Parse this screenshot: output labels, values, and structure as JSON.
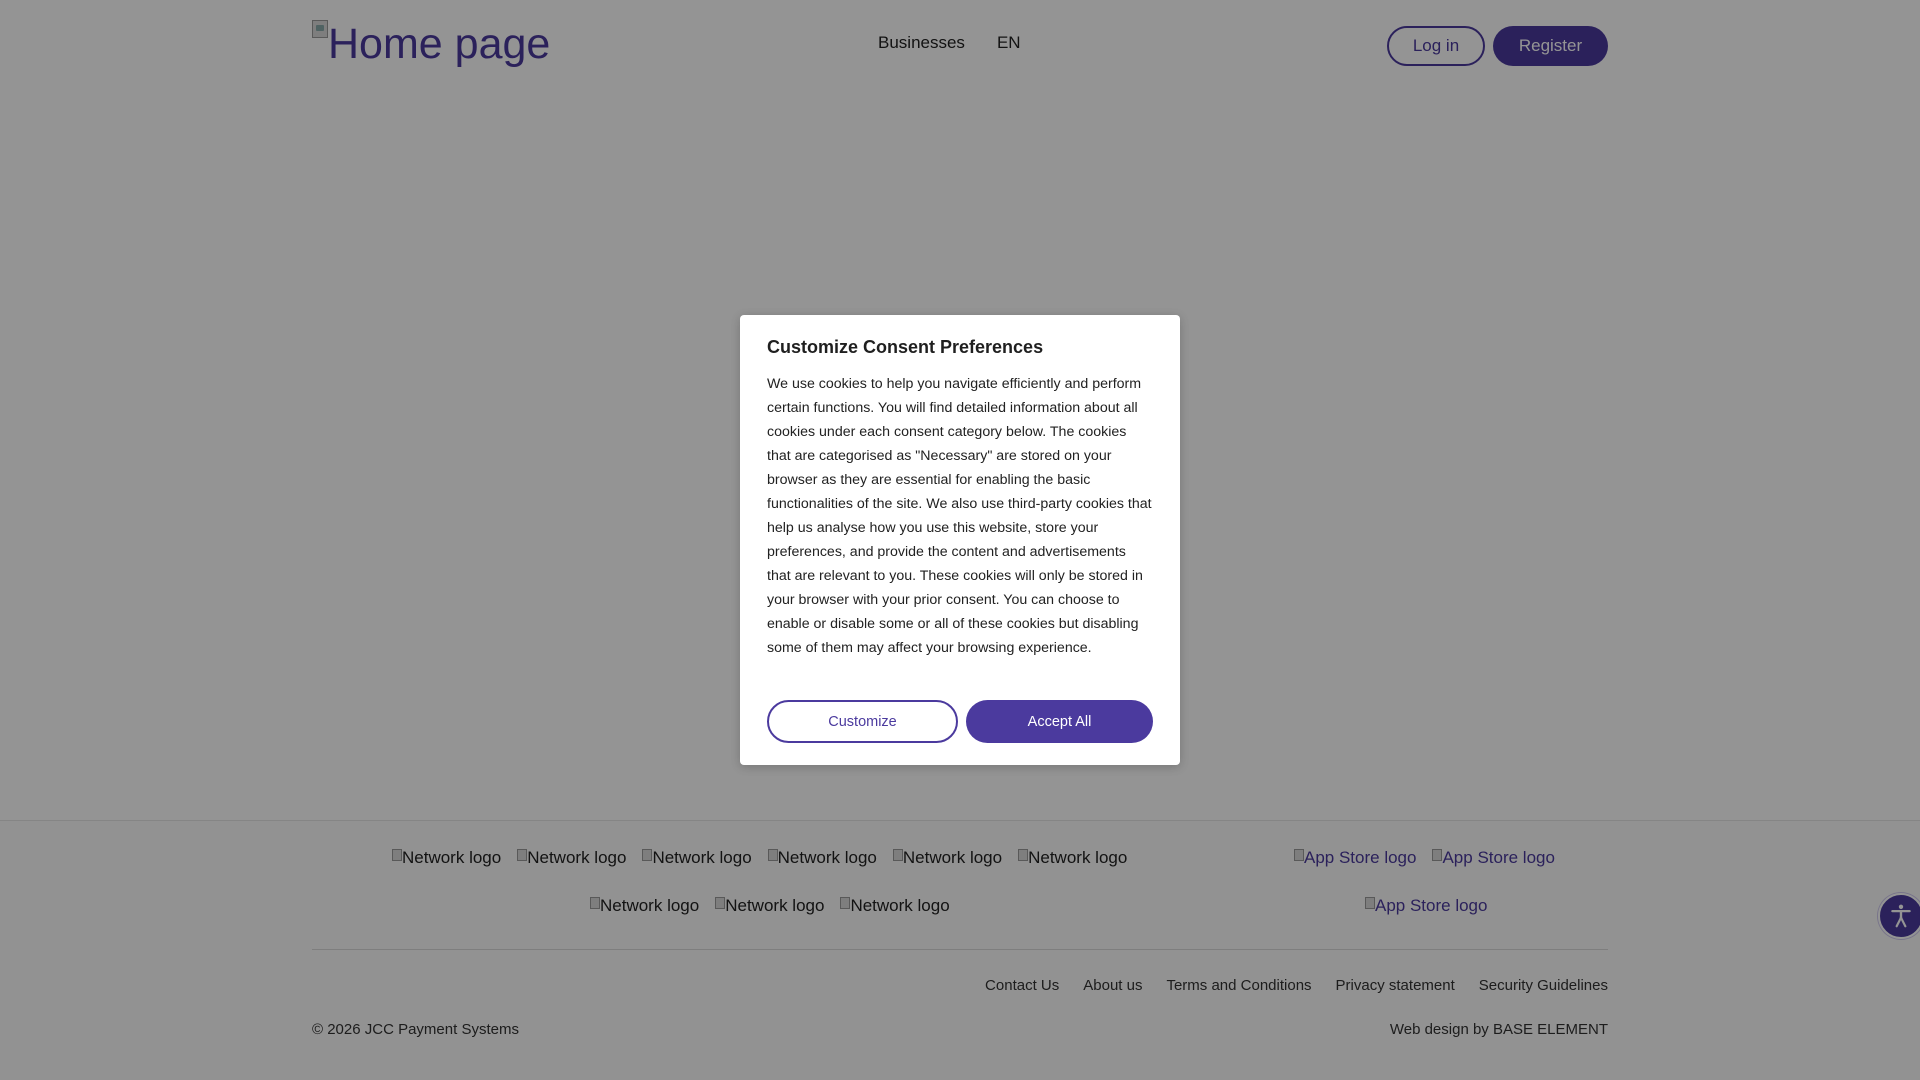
{
  "header": {
    "logo_alt": "Home page",
    "nav": [
      {
        "label": "Businesses"
      },
      {
        "label": "EN"
      }
    ],
    "login_label": "Log in",
    "register_label": "Register"
  },
  "footer": {
    "network_logo_alt": "Network logo",
    "network_logos_row1": [
      "Network logo",
      "Network logo",
      "Network logo",
      "Network logo",
      "Network logo",
      "Network logo"
    ],
    "network_logos_row2": [
      "Network logo",
      "Network logo",
      "Network logo"
    ],
    "app_logos_row1": [
      "App Store logo",
      "App Store logo"
    ],
    "app_logos_row2": [
      "App Store logo"
    ],
    "links": [
      {
        "label": "Contact Us"
      },
      {
        "label": "About us"
      },
      {
        "label": "Terms and Conditions"
      },
      {
        "label": "Privacy statement"
      },
      {
        "label": "Security Guidelines"
      }
    ],
    "copyright": "© 2026 JCC Payment Systems",
    "credit": "Web design by BASE ELEMENT"
  },
  "consent_modal": {
    "title": "Customize Consent Preferences",
    "body": "We use cookies to help you navigate efficiently and perform certain functions. You will find detailed information about all cookies under each consent category below. The cookies that are categorised as \"Necessary\" are stored on your browser as they are essential for enabling the basic functionalities of the site. We also use third-party cookies that help us analyse how you use this website, store your preferences, and provide the content and advertisements that are relevant to you. These cookies will only be stored in your browser with your prior consent. You can choose to enable or disable some or all of these cookies but disabling some of them may affect your browsing experience.",
    "customize_label": "Customize",
    "accept_label": "Accept All"
  },
  "colors": {
    "brand": "#4b3a9e",
    "overlay": "rgba(0,0,0,0.42)"
  },
  "icons": {
    "accessibility": "accessibility-icon",
    "broken_image": "broken-image-icon"
  }
}
